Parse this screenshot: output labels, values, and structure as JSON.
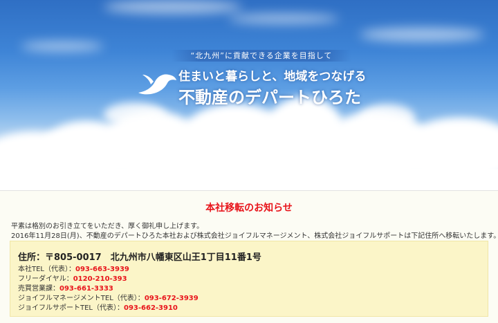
{
  "hero": {
    "tagline": "“北九州”に貢献できる企業を目指して",
    "headline1": "住まいと暮らしと、地域をつなげる",
    "headline2": "不動産のデパートひろた"
  },
  "notice": {
    "title": "本社移転のお知らせ",
    "para1": "平素は格別のお引き立てをいただき、厚く御礼申し上げます。",
    "para2": "2016年11月28日(月)、不動産のデパートひろた本社および株式会社ジョイフルマネージメント、株式会社ジョイフルサポートは下記住所へ移転いたします。",
    "address": "住所：〒805-0017　北九州市八幡東区山王1丁目11番1号",
    "tels": [
      {
        "label": "本社TEL（代表）：",
        "number": "093-663-3939"
      },
      {
        "label": "フリーダイヤル：",
        "number": "0120-210-393"
      },
      {
        "label": "売買営業課：",
        "number": "093-661-3333"
      },
      {
        "label": "ジョイフルマネージメントTEL（代表）：",
        "number": "093-672-3939"
      },
      {
        "label": "ジョイフルサポートTEL（代表）：",
        "number": "093-662-3910"
      }
    ]
  },
  "colors": {
    "accent_red": "#e8141b",
    "address_bg": "#fbf5c8",
    "sky_blue": "#3e84d6"
  },
  "icons": {
    "logo": "white-bird-logo-icon"
  }
}
